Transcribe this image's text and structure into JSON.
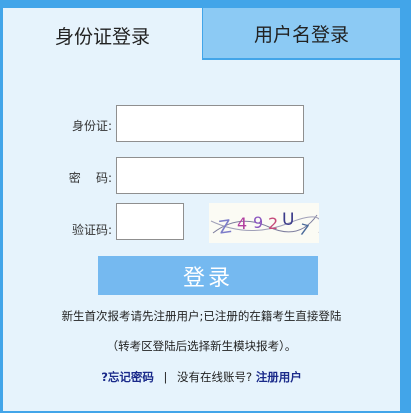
{
  "tabs": {
    "id_login": "身份证登录",
    "username_login": "用户名登录"
  },
  "form": {
    "id_label": "身份证:",
    "password_label": "密    码:",
    "captcha_label": "验证码:",
    "captcha_text": "Z492U7",
    "login_button": "登录"
  },
  "notes": {
    "line1": "新生首次报考请先注册用户;已注册的在籍考生直接登陆",
    "line2": "（转考区登陆后选择新生模块报考）。"
  },
  "links": {
    "forgot": "?忘记密码",
    "separator": "|",
    "no_account": "没有在线账号?",
    "register": "注册用户"
  },
  "colors": {
    "frame": "#42a5e9",
    "panel": "#e6f3fc",
    "inactive_tab": "#8ccaf4",
    "button": "#75b9f0"
  }
}
